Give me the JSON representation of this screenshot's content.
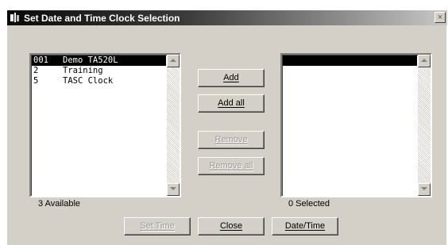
{
  "window": {
    "title": "Set Date and Time Clock Selection",
    "close_glyph": "×"
  },
  "available": {
    "items": [
      {
        "id": "001",
        "name": "Demo TA520L",
        "selected": true
      },
      {
        "id": "2",
        "name": "Training",
        "selected": false
      },
      {
        "id": "5",
        "name": "TASC Clock",
        "selected": false
      }
    ],
    "count_label": "3 Available"
  },
  "selected": {
    "items": [],
    "count_label": "0 Selected"
  },
  "buttons": {
    "add": "Add",
    "add_all": "Add all",
    "remove": "Remove",
    "remove_all": "Remove all",
    "set_time": "Set Time",
    "close": "Close",
    "date_time": "Date/Time"
  },
  "icons": {
    "title": "clock-app-icon",
    "scroll_up": "scroll-up-arrow-icon",
    "scroll_down": "scroll-down-arrow-icon",
    "close": "close-icon"
  },
  "colors": {
    "dialog_bg": "#d4d0c8",
    "selection": "#000000",
    "disabled_text": "#9a9a9a"
  }
}
